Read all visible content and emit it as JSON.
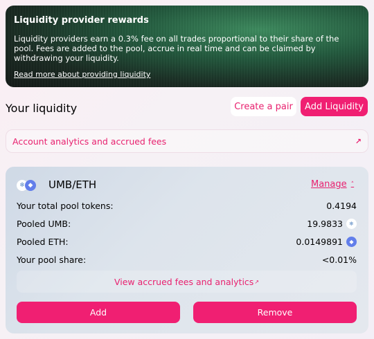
{
  "banner": {
    "title": "Liquidity provider rewards",
    "text": "Liquidity providers earn a 0.3% fee on all trades proportional to their share of the pool. Fees are added to the pool, accrue in real time and can be claimed by withdrawing your liquidity.",
    "link": "Read more about providing liquidity"
  },
  "header": {
    "title": "Your liquidity",
    "create_pair": "Create a pair",
    "add_liquidity": "Add Liquidity"
  },
  "analytics": {
    "label": "Account analytics and accrued fees"
  },
  "position": {
    "pair": "UMB/ETH",
    "manage": "Manage",
    "rows": [
      {
        "label": "Your total pool tokens:",
        "value": "0.4194"
      },
      {
        "label": "Pooled UMB:",
        "value": "19.9833",
        "icon": "umb-icon"
      },
      {
        "label": "Pooled ETH:",
        "value": "0.0149891",
        "icon": "eth-icon"
      },
      {
        "label": "Your pool share:",
        "value": "<0.01%"
      }
    ],
    "view_fees": "View accrued fees and analytics",
    "add": "Add",
    "remove": "Remove"
  },
  "colors": {
    "accent": "#f01f72",
    "link": "#e8216f"
  }
}
